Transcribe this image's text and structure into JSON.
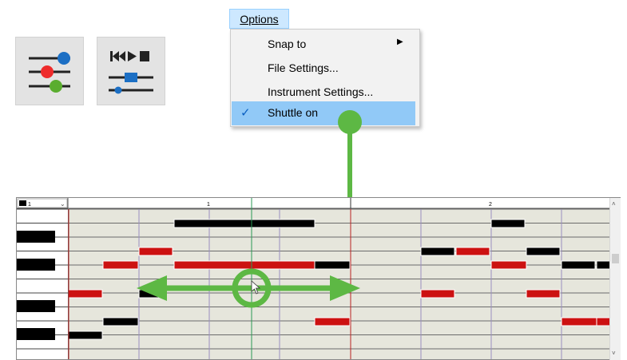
{
  "menu": {
    "title": "Options",
    "items": [
      {
        "label": "Snap to",
        "has_submenu": true,
        "checked": false
      },
      {
        "label": "File Settings...",
        "has_submenu": false,
        "checked": false
      },
      {
        "label": "Instrument Settings...",
        "has_submenu": false,
        "checked": false
      },
      {
        "label": "Shuttle on",
        "has_submenu": false,
        "checked": true
      }
    ]
  },
  "toolbar": {
    "icons": [
      "mixer-sliders-icon",
      "transport-shuttle-icon"
    ]
  },
  "roll": {
    "track_selector": "1",
    "measures": [
      "1",
      "2"
    ]
  },
  "colors": {
    "highlight_green": "#5db844",
    "note_red": "#cc1111",
    "note_black": "#000000",
    "grid_bg": "#e6e6dc",
    "menu_selected": "#91c9f7"
  }
}
